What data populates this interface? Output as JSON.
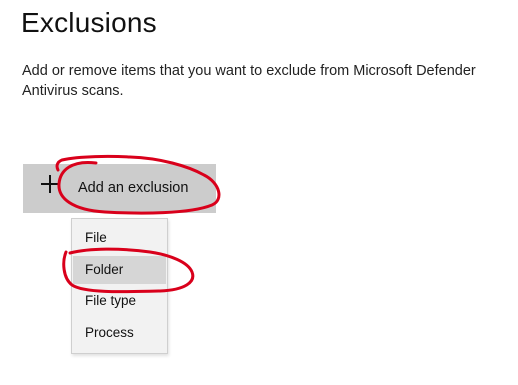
{
  "header": {
    "title": "Exclusions",
    "description": "Add or remove items that you want to exclude from Microsoft Defender Antivirus scans."
  },
  "add_button": {
    "icon": "plus-icon",
    "label": "Add an exclusion"
  },
  "menu": {
    "items": [
      {
        "label": "File",
        "selected": false
      },
      {
        "label": "Folder",
        "selected": true
      },
      {
        "label": "File type",
        "selected": false
      },
      {
        "label": "Process",
        "selected": false
      }
    ]
  },
  "annotation": {
    "color": "#d9001b"
  }
}
